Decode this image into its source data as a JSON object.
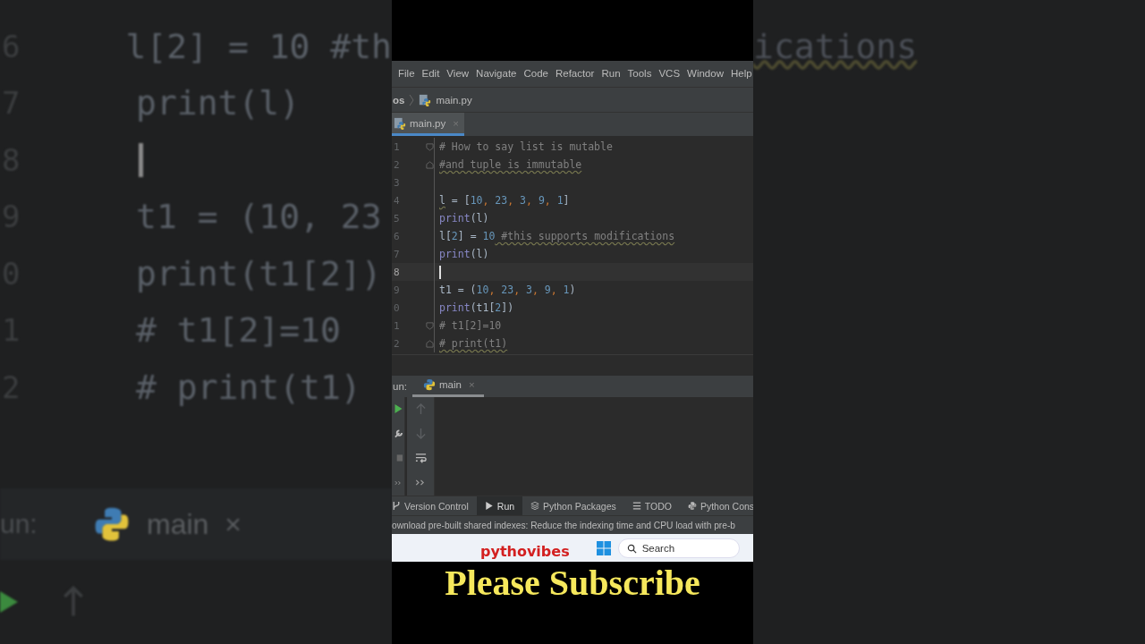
{
  "backdrop": {
    "left_lines": [
      {
        "num": "6",
        "text": "l[2] = 10 #th"
      },
      {
        "num": "7",
        "text": "print(l)"
      },
      {
        "num": "8"
      },
      {
        "num": "9",
        "text": "t1 = (10, 23"
      },
      {
        "num": "0",
        "text": "print(t1[2])"
      },
      {
        "num": "1",
        "text": "# t1[2]=10"
      },
      {
        "num": "2",
        "text": "# print(t1)"
      }
    ],
    "left_run_label": "un:",
    "left_run_tab": "main",
    "close": "×",
    "right_text": "ications"
  },
  "menu": [
    "File",
    "Edit",
    "View",
    "Navigate",
    "Code",
    "Refactor",
    "Run",
    "Tools",
    "VCS",
    "Window",
    "Help"
  ],
  "breadcrumb": {
    "parent": "os",
    "file": "main.py"
  },
  "tabs": [
    {
      "label": "main.py",
      "selected": true,
      "close": "×"
    }
  ],
  "editor": {
    "lines": [
      {
        "num": "1",
        "kind": "fold-start",
        "current": false,
        "tokens": [
          {
            "kind": "comment",
            "t": "# How to say list is mutable"
          }
        ]
      },
      {
        "num": "2",
        "kind": "fold-end",
        "current": false,
        "tokens": [
          {
            "kind": "typo",
            "t": "#and tuple is immutable"
          }
        ]
      },
      {
        "num": "3",
        "kind": "code",
        "current": false
      },
      {
        "num": "4",
        "kind": "code",
        "current": false,
        "tokens": [
          {
            "kind": "warn",
            "t": "l"
          },
          {
            "kind": "plain",
            "t": " = ["
          },
          {
            "kind": "num",
            "t": "10"
          },
          {
            "kind": "sep",
            "t": ", "
          },
          {
            "kind": "num",
            "t": "23"
          },
          {
            "kind": "sep",
            "t": ", "
          },
          {
            "kind": "num",
            "t": "3"
          },
          {
            "kind": "sep",
            "t": ", "
          },
          {
            "kind": "num",
            "t": "9"
          },
          {
            "kind": "sep",
            "t": ", "
          },
          {
            "kind": "num",
            "t": "1"
          },
          {
            "kind": "plain",
            "t": "]"
          }
        ]
      },
      {
        "num": "5",
        "kind": "code",
        "current": false,
        "tokens": [
          {
            "kind": "fn",
            "t": "print"
          },
          {
            "kind": "plain",
            "t": "(l)"
          }
        ]
      },
      {
        "num": "6",
        "kind": "code",
        "current": false,
        "tokens": [
          {
            "kind": "plain",
            "t": "l["
          },
          {
            "kind": "num",
            "t": "2"
          },
          {
            "kind": "plain",
            "t": "] = "
          },
          {
            "kind": "num",
            "t": "10"
          },
          {
            "kind": "typo",
            "t": " #this supports modifications"
          }
        ]
      },
      {
        "num": "7",
        "kind": "code",
        "current": false,
        "tokens": [
          {
            "kind": "fn",
            "t": "print"
          },
          {
            "kind": "plain",
            "t": "(l)"
          }
        ]
      },
      {
        "num": "8",
        "kind": "code",
        "current": true
      },
      {
        "num": "9",
        "kind": "code",
        "current": false,
        "tokens": [
          {
            "kind": "plain",
            "t": "t1 = ("
          },
          {
            "kind": "num",
            "t": "10"
          },
          {
            "kind": "sep",
            "t": ", "
          },
          {
            "kind": "num",
            "t": "23"
          },
          {
            "kind": "sep",
            "t": ", "
          },
          {
            "kind": "num",
            "t": "3"
          },
          {
            "kind": "sep",
            "t": ", "
          },
          {
            "kind": "num",
            "t": "9"
          },
          {
            "kind": "sep",
            "t": ", "
          },
          {
            "kind": "num",
            "t": "1"
          },
          {
            "kind": "plain",
            "t": ")"
          }
        ]
      },
      {
        "num": "0",
        "kind": "code",
        "current": false,
        "tokens": [
          {
            "kind": "fn",
            "t": "print"
          },
          {
            "kind": "plain",
            "t": "(t1["
          },
          {
            "kind": "num",
            "t": "2"
          },
          {
            "kind": "plain",
            "t": "])"
          }
        ]
      },
      {
        "num": "1",
        "kind": "fold-start",
        "current": false,
        "tokens": [
          {
            "kind": "comment",
            "t": "# t1[2]=10"
          }
        ]
      },
      {
        "num": "2",
        "kind": "fold-end",
        "current": false,
        "tokens": [
          {
            "kind": "typo",
            "t": "# print(t1)"
          }
        ]
      }
    ]
  },
  "run_panel": {
    "label": "un:",
    "tab": "main",
    "close": "×"
  },
  "tool_windows": [
    {
      "label": "Version Control",
      "kind": "vcs",
      "selected": false
    },
    {
      "label": "Run",
      "kind": "run",
      "selected": true
    },
    {
      "label": "Python Packages",
      "kind": "packages",
      "selected": false
    },
    {
      "label": "TODO",
      "kind": "list",
      "selected": false
    },
    {
      "label": "Python Cons",
      "kind": "python",
      "selected": false
    }
  ],
  "status_bar": "ownload pre-built shared indexes: Reduce the indexing time and CPU load with pre-b",
  "taskbar": {
    "brand": "pythovibes",
    "search_placeholder": "Search"
  },
  "caption": "Please Subscribe"
}
